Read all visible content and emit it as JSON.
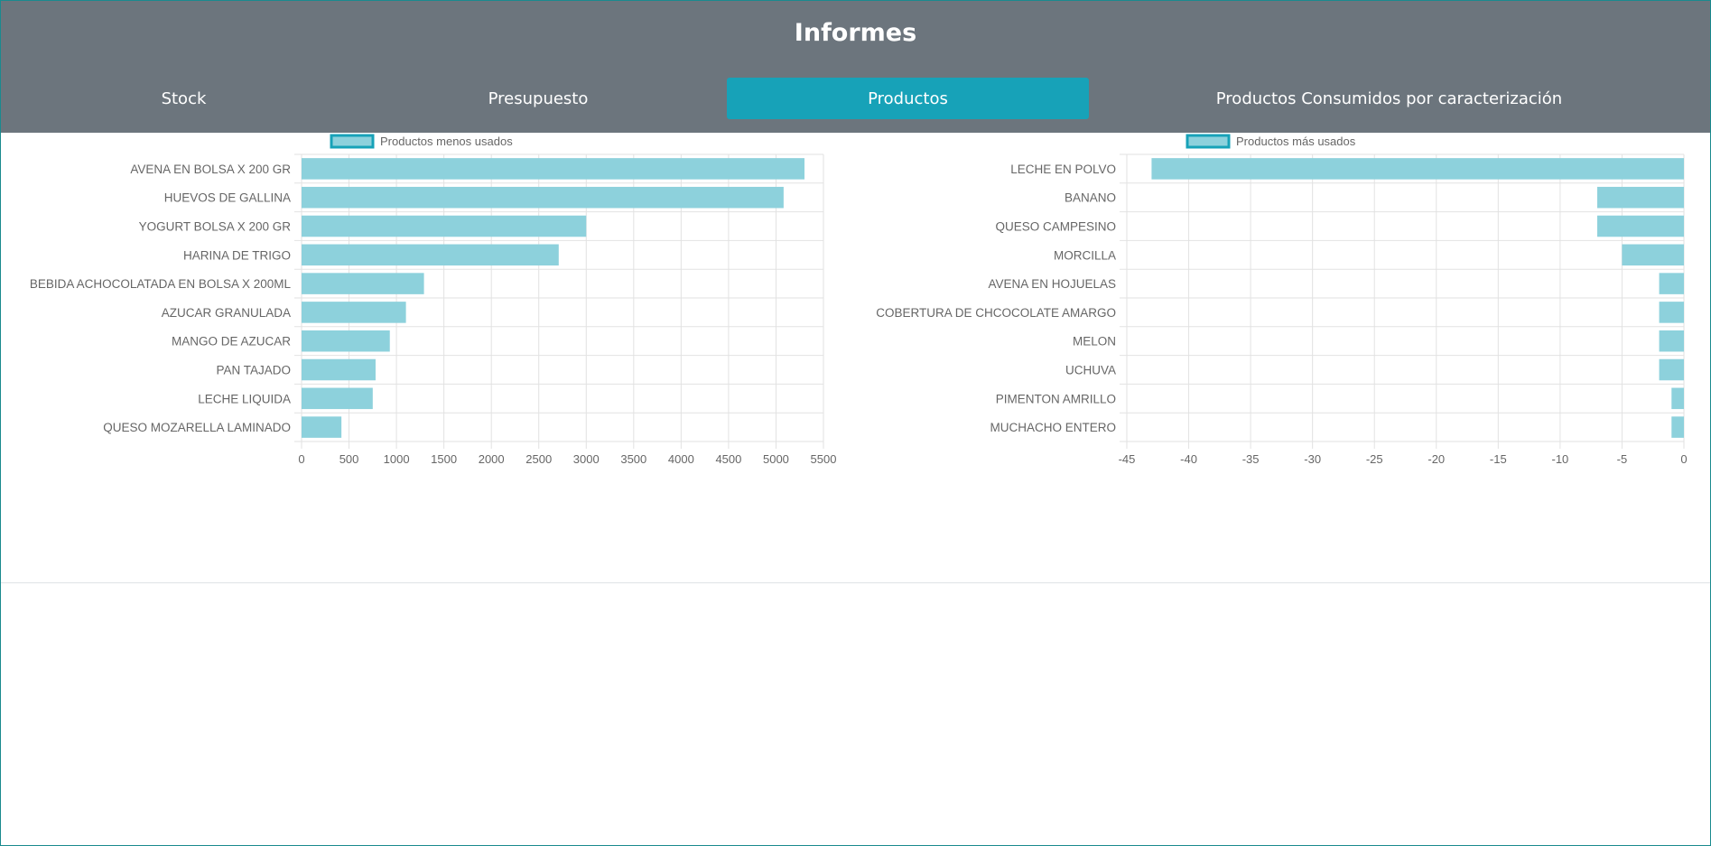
{
  "header": {
    "title": "Informes"
  },
  "tabs": [
    {
      "label": "Stock",
      "active": false
    },
    {
      "label": "Presupuesto",
      "active": false
    },
    {
      "label": "Productos",
      "active": true
    },
    {
      "label": "Productos Consumidos por caracterización",
      "active": false
    }
  ],
  "colors": {
    "header_bg": "#6c757d",
    "active_tab": "#17a2b8",
    "bar_fill": "#8dd1dc",
    "bar_border": "#17a2b8"
  },
  "chart_data": [
    {
      "type": "bar",
      "orientation": "horizontal",
      "legend": "Productos menos usados",
      "legend_position": "top",
      "categories": [
        "AVENA EN BOLSA X 200 GR",
        "HUEVOS DE GALLINA",
        "YOGURT BOLSA X 200  GR",
        "HARINA DE TRIGO",
        "BEBIDA ACHOCOLATADA EN BOLSA X 200ML",
        "AZUCAR GRANULADA",
        "MANGO DE AZUCAR",
        "PAN TAJADO",
        "LECHE LIQUIDA",
        "QUESO MOZARELLA  LAMINADO"
      ],
      "values": [
        5300,
        5080,
        3000,
        2710,
        1290,
        1100,
        930,
        780,
        750,
        420
      ],
      "xlim": [
        0,
        5500
      ],
      "xticks": [
        "0",
        "500",
        "1000",
        "1500",
        "2000",
        "2500",
        "3000",
        "3500",
        "4000",
        "4500",
        "5000",
        "5500"
      ],
      "grid": true
    },
    {
      "type": "bar",
      "orientation": "horizontal",
      "legend": "Productos más usados",
      "legend_position": "top",
      "categories": [
        "LECHE EN POLVO",
        "BANANO",
        "QUESO CAMPESINO",
        "MORCILLA",
        "AVENA EN HOJUELAS",
        "COBERTURA DE CHCOCOLATE AMARGO",
        "MELON",
        "UCHUVA",
        "PIMENTON AMRILLO",
        "MUCHACHO ENTERO"
      ],
      "values": [
        -43,
        -7,
        -7,
        -5,
        -2,
        -2,
        -2,
        -2,
        -1,
        -1
      ],
      "xlim": [
        -45,
        0
      ],
      "xticks": [
        "-45",
        "-40",
        "-35",
        "-30",
        "-25",
        "-20",
        "-15",
        "-10",
        "-5",
        "0"
      ],
      "grid": true
    }
  ]
}
